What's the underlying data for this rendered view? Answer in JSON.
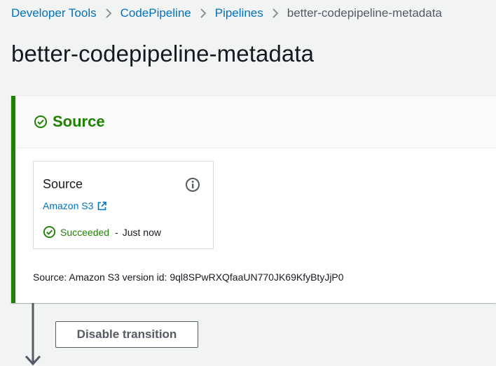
{
  "breadcrumb": {
    "items": [
      "Developer Tools",
      "CodePipeline",
      "Pipelines"
    ],
    "current": "better-codepipeline-metadata"
  },
  "page": {
    "title": "better-codepipeline-metadata"
  },
  "stage": {
    "name": "Source",
    "status_color": "#1d8102",
    "action": {
      "name": "Source",
      "provider_link": "Amazon S3",
      "status": "Succeeded",
      "separator": "-",
      "time": "Just now"
    },
    "revision_text": "Source: Amazon S3 version id: 9ql8SPwRXQfaaUN770JK69KfyBtyJjP0"
  },
  "transition": {
    "button_label": "Disable transition"
  },
  "icons": {
    "stage_status": "check-circle-icon",
    "info": "info-icon",
    "external_link": "external-link-icon",
    "action_status": "check-circle-icon",
    "arrow": "arrow-down-icon"
  }
}
